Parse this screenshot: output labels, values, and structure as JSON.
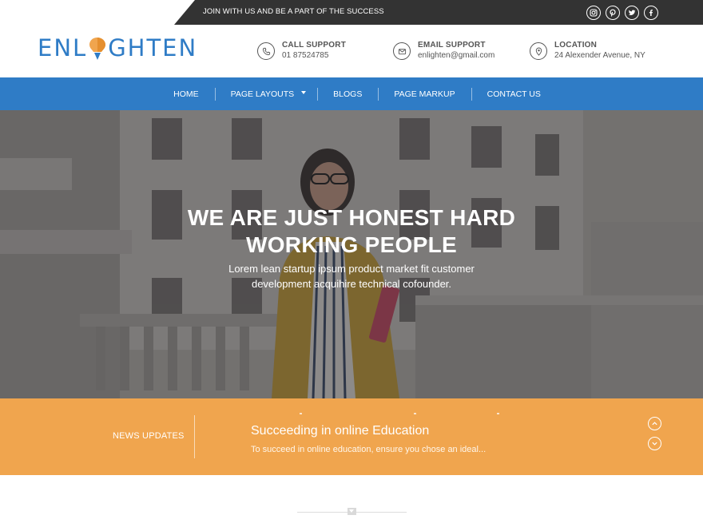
{
  "topbar": {
    "tagline": "JOIN WITH US AND BE A PART OF THE SUCCESS",
    "social": [
      {
        "icon": "instagram-icon"
      },
      {
        "icon": "pinterest-icon"
      },
      {
        "icon": "twitter-icon"
      },
      {
        "icon": "facebook-icon"
      }
    ]
  },
  "header": {
    "logo_left": "ENL",
    "logo_right": "GHTEN",
    "contacts": [
      {
        "title": "CALL SUPPORT",
        "value": "01 87524785",
        "icon": "phone-icon"
      },
      {
        "title": "EMAIL SUPPORT",
        "value": "enlighten@gmail.com",
        "icon": "mail-icon"
      },
      {
        "title": "LOCATION",
        "value": "24 Alexender Avenue, NY",
        "icon": "location-pin-icon"
      }
    ]
  },
  "nav": {
    "items": [
      {
        "label": "HOME"
      },
      {
        "label": "PAGE LAYOUTS",
        "has_dropdown": true
      },
      {
        "label": "BLOGS"
      },
      {
        "label": "PAGE MARKUP"
      },
      {
        "label": "CONTACT US"
      }
    ],
    "bg_color": "#2f7cc6"
  },
  "hero": {
    "title_line1": "WE ARE JUST HONEST HARD",
    "title_line2": "WORKING PEOPLE",
    "subtitle_line1": "Lorem lean startup ipsum product market fit customer",
    "subtitle_line2": "development acquihire technical cofounder."
  },
  "news": {
    "label": "NEWS UPDATES",
    "title": "Succeeding in online Education",
    "text": "To succeed in online education, ensure you chose an ideal...",
    "bg_color": "#f0a54e"
  }
}
